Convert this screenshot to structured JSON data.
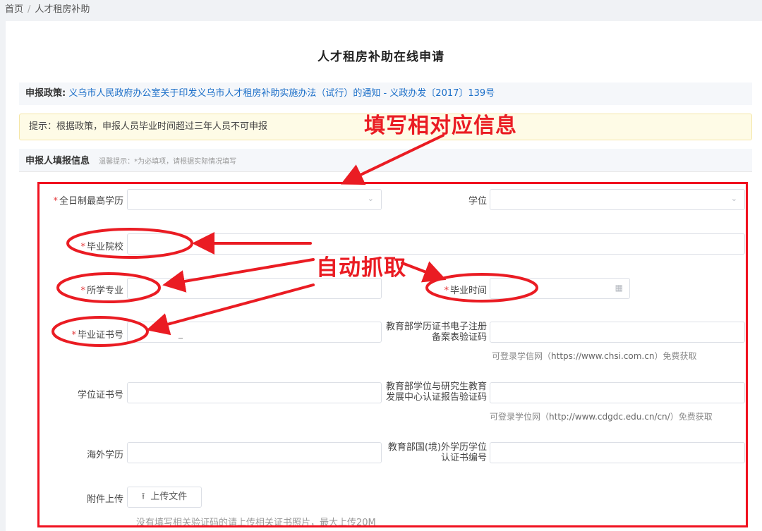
{
  "breadcrumb": {
    "home": "首页",
    "separator": "/",
    "current": "人才租房补助"
  },
  "page_title": "人才租房补助在线申请",
  "policy": {
    "label": "申报政策:",
    "link_text": "义乌市人民政府办公室关于印发义乌市人才租房补助实施办法（试行）的通知 - 义政办发〔2017〕139号"
  },
  "tip": "提示：根据政策，申报人员毕业时间超过三年人员不可申报",
  "section": {
    "title": "申报人填报信息",
    "hint": "温馨提示：*为必填项，请根据实际情况填写"
  },
  "form": {
    "required_mark": "*",
    "edu_label": "全日制最高学历",
    "degree_label": "学位",
    "school_label": "毕业院校",
    "major_label": "所学专业",
    "grad_time_label": "毕业时间",
    "grad_cert_label": "毕业证书号",
    "chsi_label": "教育部学历证书电子注册备案表验证码",
    "chsi_help_prefix": "可登录学信网（",
    "chsi_help_url": "https://www.chsi.com.cn",
    "chsi_help_suffix": "）免费获取",
    "degree_cert_label": "学位证书号",
    "cdgdc_label": "教育部学位与研究生教育发展中心认证报告验证码",
    "cdgdc_help_prefix": "可登录学位网（",
    "cdgdc_help_url": "http://www.cdgdc.edu.cn/cn/",
    "cdgdc_help_suffix": "）免费获取",
    "overseas_label": "海外学历",
    "overseas_cert_label": "教育部国(境)外学历学位认证书编号",
    "attach_label": "附件上传",
    "upload_button": "上传文件",
    "upload_help": "没有填写相关验证码的请上传相关证书照片，最大上传20M"
  },
  "annotations": {
    "fill_info": "填写相对应信息",
    "auto_fetch": "自动抓取"
  },
  "icons": {
    "select_arrow": "chevron-down-icon",
    "date": "calendar-icon",
    "upload": "upload-icon"
  },
  "colors": {
    "annotation": "#ea1c23",
    "link": "#1a6ec8",
    "required": "#e4393c",
    "tip_bg": "#fefbe6"
  }
}
